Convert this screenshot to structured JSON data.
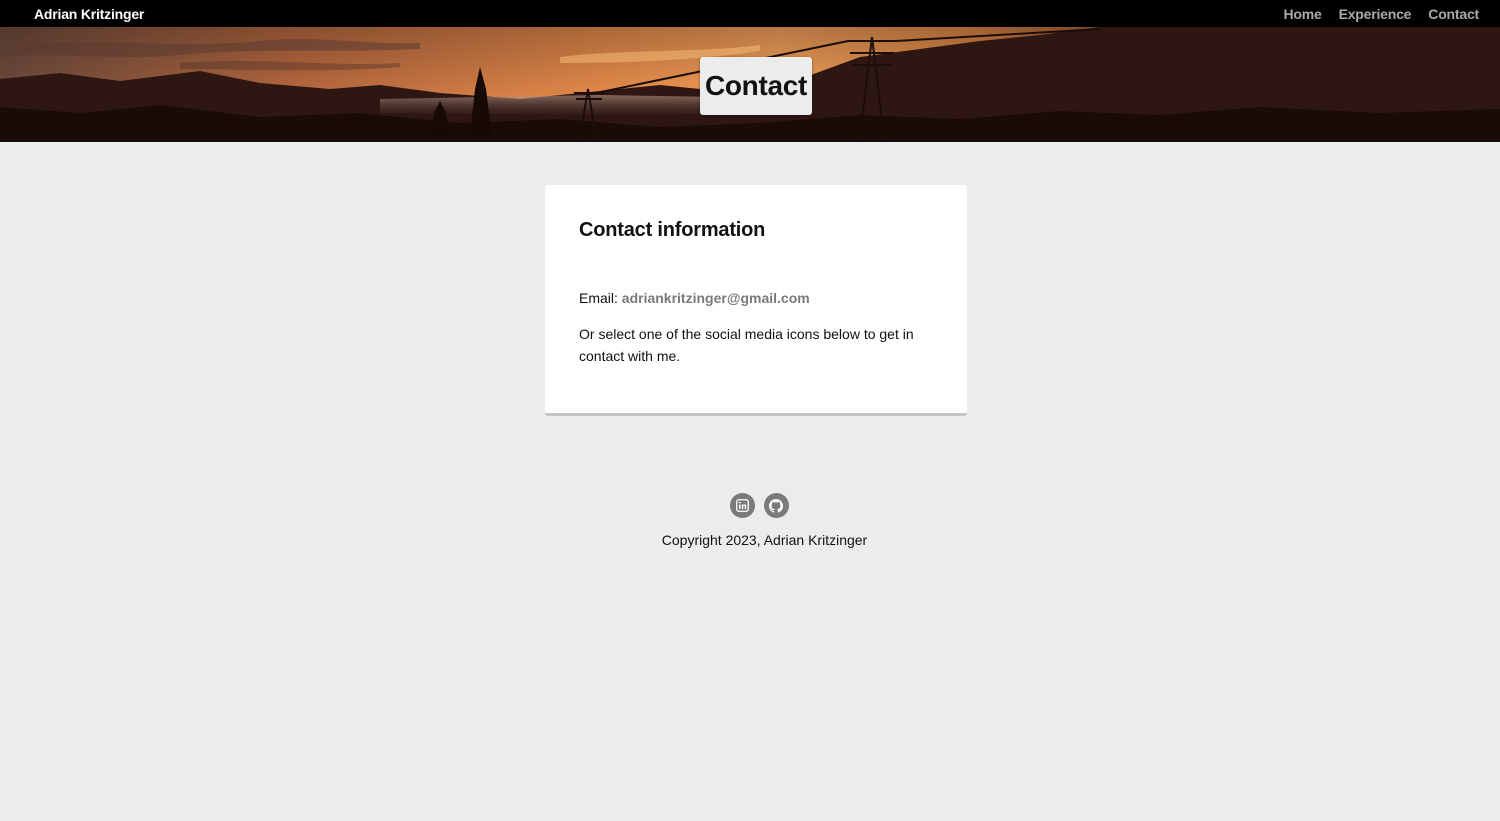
{
  "navbar": {
    "brand": "Adrian Kritzinger",
    "links": [
      {
        "label": "Home"
      },
      {
        "label": "Experience"
      },
      {
        "label": "Contact"
      }
    ]
  },
  "hero": {
    "title": "Contact"
  },
  "card": {
    "heading": "Contact information",
    "email_label": "Email:",
    "email_value": "adriankritzinger@gmail.com",
    "description": "Or select one of the social media icons below to get in contact with me."
  },
  "footer": {
    "social_icons": [
      "linkedin-icon",
      "github-icon"
    ],
    "copyright": "Copyright 2023, Adrian Kritzinger"
  },
  "colors": {
    "navbar_bg": "#000000",
    "page_bg": "#ececec",
    "link_gray": "#7a7a7a",
    "nav_link_gray": "#a9a9a9"
  }
}
